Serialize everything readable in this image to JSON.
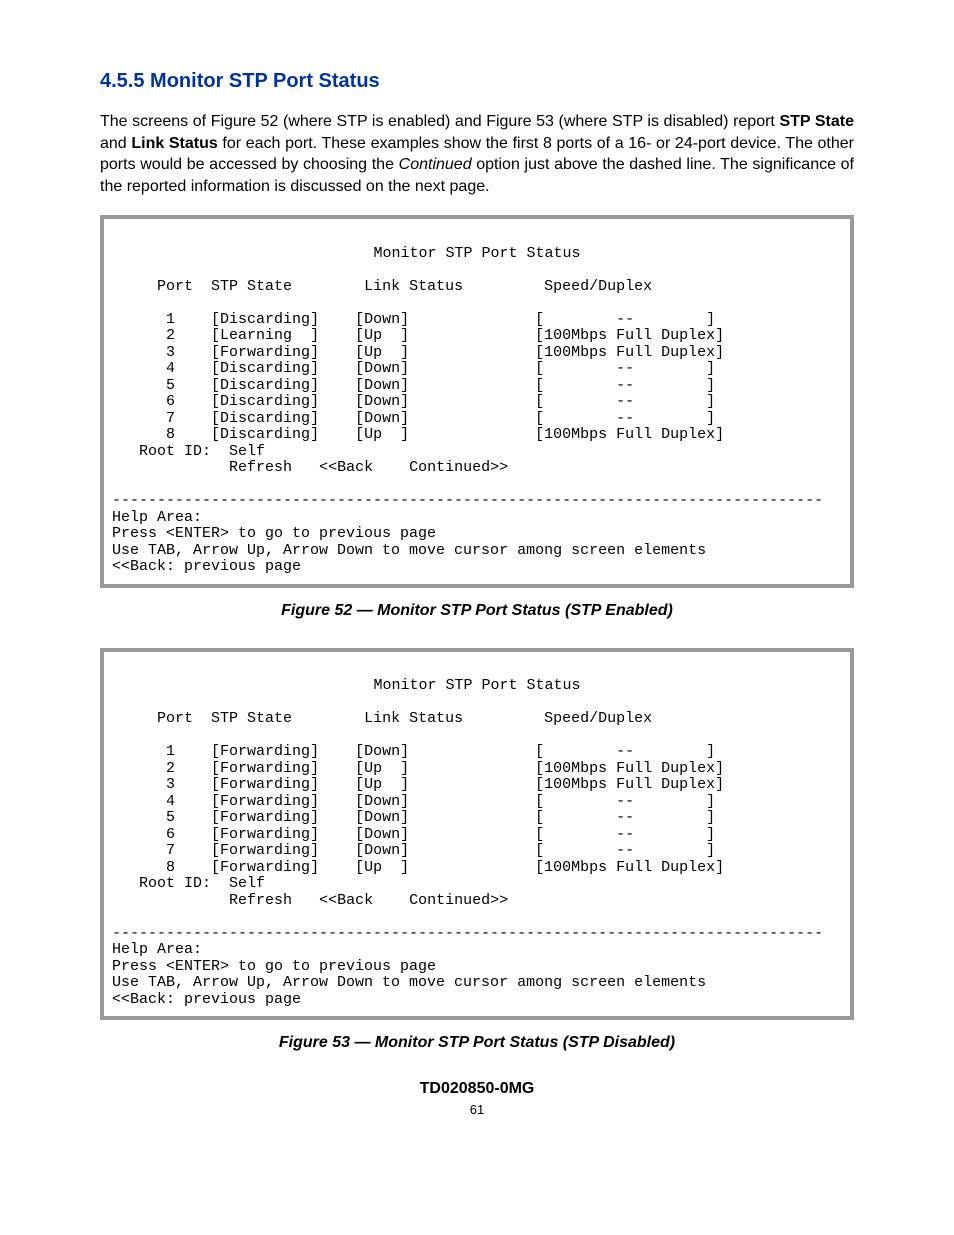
{
  "heading": "4.5.5   Monitor STP Port Status",
  "intro": {
    "p1a": "The screens of Figure 52 (where STP is enabled) and Figure 53 (where STP is disabled) report ",
    "p1b": "STP State",
    "p1c": " and ",
    "p1d": "Link Status",
    "p1e": " for each port.  These examples show the first 8 ports of a 16- or 24-port device.  The other ports would be accessed by choosing the ",
    "p1f": "Continued",
    "p1g": " option just above the dashed line.  The significance of the reported information is discussed on the next page."
  },
  "fig52": {
    "title": "Monitor STP Port Status",
    "headers": {
      "port": "Port",
      "stp": "STP State",
      "link": "Link Status",
      "speed": "Speed/Duplex"
    },
    "rows": [
      {
        "port": "1",
        "stp": "[Discarding]",
        "link": "[Down]",
        "speed": "[        --        ]"
      },
      {
        "port": "2",
        "stp": "[Learning  ]",
        "link": "[Up  ]",
        "speed": "[100Mbps Full Duplex]"
      },
      {
        "port": "3",
        "stp": "[Forwarding]",
        "link": "[Up  ]",
        "speed": "[100Mbps Full Duplex]"
      },
      {
        "port": "4",
        "stp": "[Discarding]",
        "link": "[Down]",
        "speed": "[        --        ]"
      },
      {
        "port": "5",
        "stp": "[Discarding]",
        "link": "[Down]",
        "speed": "[        --        ]"
      },
      {
        "port": "6",
        "stp": "[Discarding]",
        "link": "[Down]",
        "speed": "[        --        ]"
      },
      {
        "port": "7",
        "stp": "[Discarding]",
        "link": "[Down]",
        "speed": "[        --        ]"
      },
      {
        "port": "8",
        "stp": "[Discarding]",
        "link": "[Up  ]",
        "speed": "[100Mbps Full Duplex]"
      }
    ],
    "root": "Root ID:  Self",
    "actions": {
      "refresh": "Refresh",
      "back": "<<Back",
      "cont": "Continued>>"
    },
    "dashes": "-------------------------------------------------------------------------------",
    "help_title": "Help Area:",
    "help1": "Press <ENTER> to go to previous page",
    "help2": "Use TAB, Arrow Up, Arrow Down to move cursor among screen elements",
    "help3": "<<Back: previous page",
    "caption": "Figure 52 — Monitor STP Port Status (STP Enabled)"
  },
  "fig53": {
    "title": "Monitor STP Port Status",
    "headers": {
      "port": "Port",
      "stp": "STP State",
      "link": "Link Status",
      "speed": "Speed/Duplex"
    },
    "rows": [
      {
        "port": "1",
        "stp": "[Forwarding]",
        "link": "[Down]",
        "speed": "[        --        ]"
      },
      {
        "port": "2",
        "stp": "[Forwarding]",
        "link": "[Up  ]",
        "speed": "[100Mbps Full Duplex]"
      },
      {
        "port": "3",
        "stp": "[Forwarding]",
        "link": "[Up  ]",
        "speed": "[100Mbps Full Duplex]"
      },
      {
        "port": "4",
        "stp": "[Forwarding]",
        "link": "[Down]",
        "speed": "[        --        ]"
      },
      {
        "port": "5",
        "stp": "[Forwarding]",
        "link": "[Down]",
        "speed": "[        --        ]"
      },
      {
        "port": "6",
        "stp": "[Forwarding]",
        "link": "[Down]",
        "speed": "[        --        ]"
      },
      {
        "port": "7",
        "stp": "[Forwarding]",
        "link": "[Down]",
        "speed": "[        --        ]"
      },
      {
        "port": "8",
        "stp": "[Forwarding]",
        "link": "[Up  ]",
        "speed": "[100Mbps Full Duplex]"
      }
    ],
    "root": "Root ID:  Self",
    "actions": {
      "refresh": "Refresh",
      "back": "<<Back",
      "cont": "Continued>>"
    },
    "dashes": "-------------------------------------------------------------------------------",
    "help_title": "Help Area:",
    "help1": "Press <ENTER> to go to previous page",
    "help2": "Use TAB, Arrow Up, Arrow Down to move cursor among screen elements",
    "help3": "<<Back: previous page",
    "caption": "Figure 53 — Monitor STP Port Status (STP Disabled)"
  },
  "doc_id": "TD020850-0MG",
  "page_no": "61"
}
